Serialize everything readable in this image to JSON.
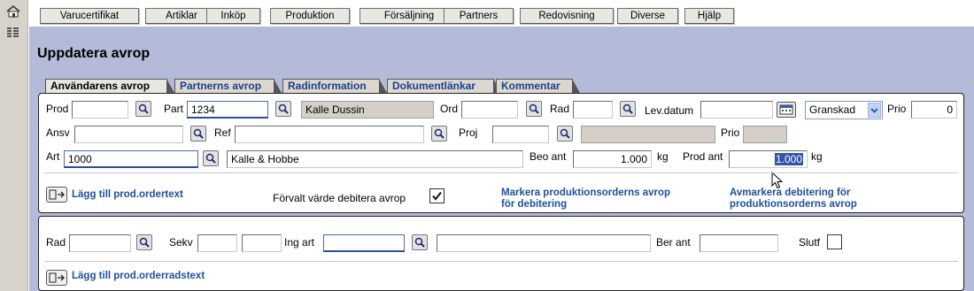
{
  "menu": [
    "Varucertifikat",
    "Artiklar",
    "Inköp",
    "Produktion",
    "Försäljning",
    "Partners",
    "Redovisning",
    "Diverse",
    "Hjälp"
  ],
  "page_title": "Uppdatera avrop",
  "tabs": [
    "Användarens avrop",
    "Partnerns avrop",
    "Radinformation",
    "Dokumentlänkar",
    "Kommentar"
  ],
  "form1": {
    "prod_label": "Prod",
    "prod_value": "",
    "part_label": "Part",
    "part_value": "1234",
    "part_name": "Kalle Dussin",
    "ord_label": "Ord",
    "ord_value": "",
    "rad_label": "Rad",
    "rad_value": "",
    "levdatum_label": "Lev.datum",
    "levdatum_value": "",
    "status_value": "Granskad",
    "prio_label": "Prio",
    "prio_value": "0",
    "ansv_label": "Ansv",
    "ansv_value": "",
    "ref_label": "Ref",
    "ref_value": "",
    "proj_label": "Proj",
    "proj_value": "",
    "proj_name": "",
    "prio2_label": "Prio",
    "prio2_value": "",
    "art_label": "Art",
    "art_value": "1000",
    "art_name": "Kalle & Hobbe",
    "beo_ant_label": "Beo ant",
    "beo_ant_value": "1.000",
    "beo_unit": "kg",
    "prod_ant_label": "Prod ant",
    "prod_ant_value": "1.000",
    "prod_unit": "kg",
    "add_text_link": "Lägg till prod.ordertext",
    "debit_label": "Förvalt värde debitera avrop",
    "debit_checked": true,
    "mark_link": "Markera produktionsorderns avrop för debitering",
    "unmark_link": "Avmarkera debitering för produktionsorderns avrop"
  },
  "form2": {
    "rad_label": "Rad",
    "rad_value": "",
    "sekv_label": "Sekv",
    "sekv_value1": "",
    "sekv_value2": "",
    "ingart_label": "Ing art",
    "ingart_value": "",
    "ingart_name": "",
    "berant_label": "Ber ant",
    "berant_value": "",
    "slutf_label": "Slutf",
    "slutf_checked": false,
    "add_row_text_link": "Lägg till prod.orderradstext"
  },
  "colors": {
    "background": "#b4bbd8",
    "link": "#1e4f9c",
    "tab_text": "#1a3f8f"
  },
  "icons": {
    "lookup": "magnifier-icon",
    "calendar": "calendar-icon",
    "home": "home-icon",
    "menu": "list-icon"
  }
}
